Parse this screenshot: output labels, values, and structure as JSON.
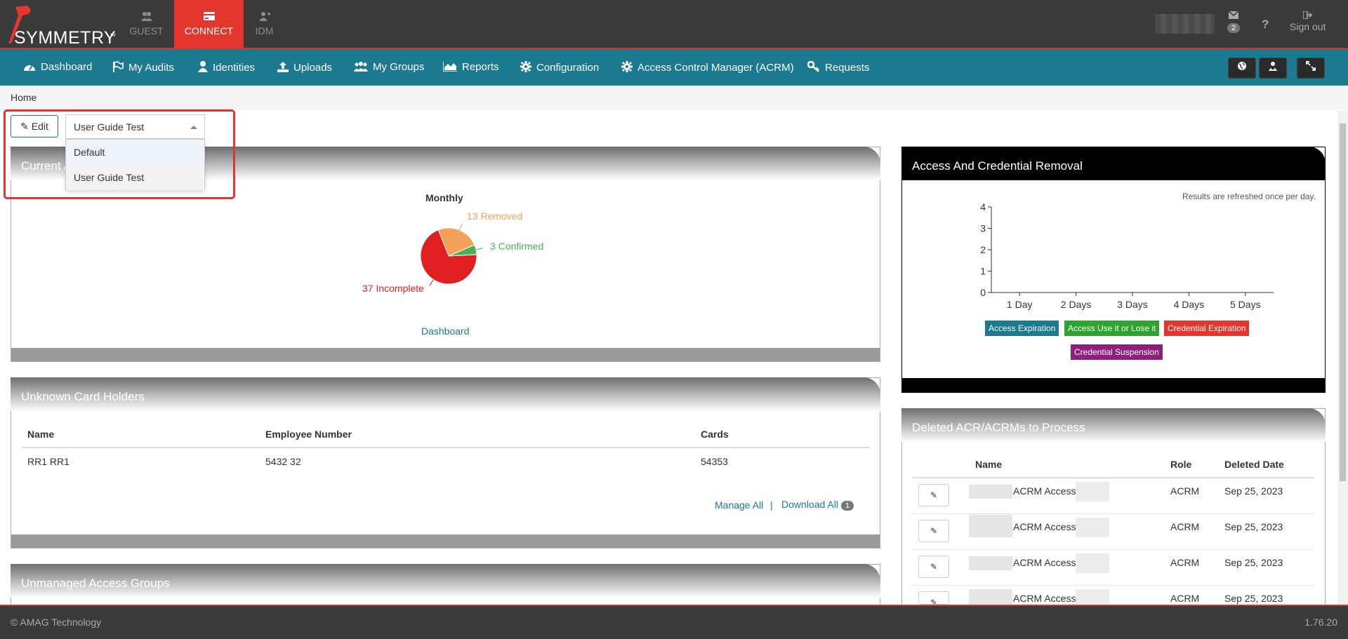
{
  "brand": {
    "name": "SYMMETRY",
    "tm": "™"
  },
  "top_tabs": [
    {
      "label": "GUEST",
      "icon": "users-icon"
    },
    {
      "label": "CONNECT",
      "icon": "card-icon",
      "active": true
    },
    {
      "label": "IDM",
      "icon": "user-plus-icon"
    }
  ],
  "top_right": {
    "mail_count": "2",
    "help": "?",
    "signout": "Sign out"
  },
  "nav": [
    {
      "label": "Dashboard",
      "icon": "dashboard-icon"
    },
    {
      "label": "My Audits",
      "icon": "flag-icon"
    },
    {
      "label": "Identities",
      "icon": "user-icon"
    },
    {
      "label": "Uploads",
      "icon": "upload-icon"
    },
    {
      "label": "My Groups",
      "icon": "group-icon"
    },
    {
      "label": "Reports",
      "icon": "area-chart-icon"
    },
    {
      "label": "Configuration",
      "icon": "gear-icon"
    },
    {
      "label": "Access Control Manager (ACRM)",
      "icon": "gear-icon"
    },
    {
      "label": "Requests",
      "icon": "key-icon"
    }
  ],
  "breadcrumb": "Home",
  "toolbar": {
    "edit_label": "Edit",
    "select_value": "User Guide Test",
    "options": [
      "Default",
      "User Guide Test"
    ]
  },
  "panel_current": {
    "title": "Current A",
    "chart_title": "Monthly",
    "dashboard_link": "Dashboard"
  },
  "chart_data": [
    {
      "type": "pie",
      "title": "Monthly",
      "slices": [
        {
          "label": "13 Removed",
          "value": 13,
          "color": "#f5a05a"
        },
        {
          "label": "3 Confirmed",
          "value": 3,
          "color": "#4caf50"
        },
        {
          "label": "37 Incomplete",
          "value": 37,
          "color": "#e02020"
        }
      ]
    },
    {
      "type": "bar",
      "title": "",
      "categories": [
        "1 Day",
        "2 Days",
        "3 Days",
        "4 Days",
        "5 Days"
      ],
      "series": [
        {
          "name": "Access Expiration",
          "values": [
            0,
            0,
            0,
            0,
            0
          ],
          "color": "#1b7a8f"
        },
        {
          "name": "Access Use it or Lose it",
          "values": [
            0,
            0,
            0,
            0,
            0
          ],
          "color": "#2ea32e"
        },
        {
          "name": "Credential Expiration",
          "values": [
            0,
            0,
            0,
            0,
            0
          ],
          "color": "#e3372d"
        },
        {
          "name": "Credential Suspension",
          "values": [
            0,
            0,
            0,
            0,
            0
          ],
          "color": "#8e1f7c"
        }
      ],
      "yticks": [
        "0",
        "1",
        "2",
        "3",
        "4"
      ],
      "ylim": [
        0,
        4
      ],
      "legend": "bottom"
    }
  ],
  "panel_unknown": {
    "title": "Unknown Card Holders",
    "headers": [
      "Name",
      "Employee Number",
      "Cards"
    ],
    "rows": [
      {
        "name": "RR1 RR1",
        "employee_number": "5432 32",
        "cards": "54353"
      }
    ],
    "manage_all": "Manage All",
    "separator": "|",
    "download_all": "Download All",
    "download_count": "1"
  },
  "panel_unmanaged": {
    "title": "Unmanaged Access Groups"
  },
  "panel_access": {
    "title": "Access And Credential Removal",
    "note": "Results are refreshed once per day."
  },
  "panel_deleted": {
    "title": "Deleted ACR/ACRMs to Process",
    "headers": [
      "Name",
      "Role",
      "Deleted Date"
    ],
    "rows": [
      {
        "name": "ACRM Access",
        "role": "ACRM",
        "date": "Sep 25, 2023"
      },
      {
        "name": "ACRM Access",
        "role": "ACRM",
        "date": "Sep 25, 2023"
      },
      {
        "name": "ACRM Access",
        "role": "ACRM",
        "date": "Sep 25, 2023"
      },
      {
        "name": "ACRM Access",
        "role": "ACRM",
        "date": "Sep 25, 2023"
      }
    ]
  },
  "footer": {
    "copyright": "© AMAG Technology",
    "version": "1.76.20"
  }
}
